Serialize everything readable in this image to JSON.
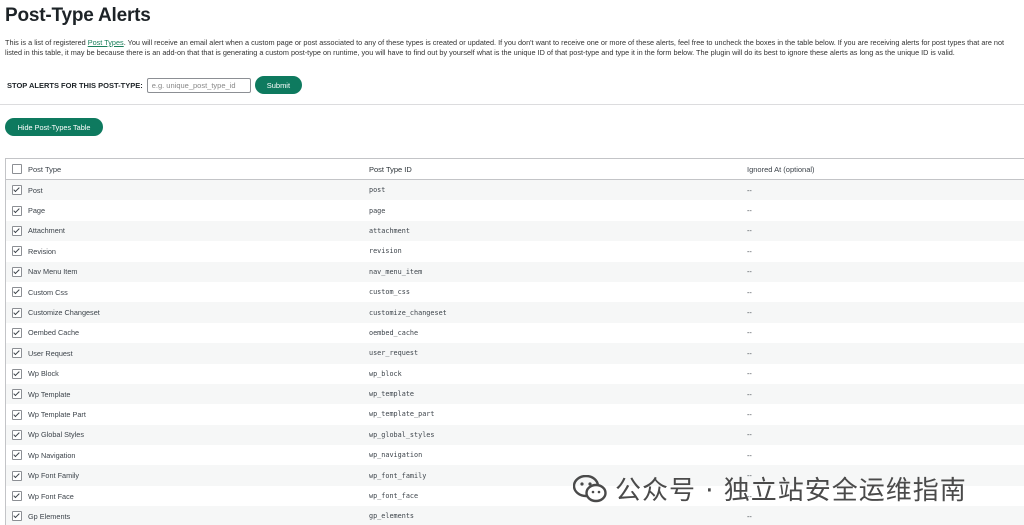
{
  "page": {
    "title": "Post-Type Alerts",
    "description_pre": "This is a list of registered ",
    "description_link": "Post Types",
    "description_post": ". You will receive an email alert when a custom page or post associated to any of these types is created or updated. If you don't want to receive one or more of these alerts, feel free to uncheck the boxes in the table below. If you are receiving alerts for post types that are not listed in this table, it may be because there is an add-on that that is generating a custom post-type on runtime, you will have to find out by yourself what is the unique ID of that post-type and type it in the form below. The plugin will do its best to ignore these alerts as long as the unique ID is valid."
  },
  "stop_form": {
    "label": "STOP ALERTS FOR THIS POST-TYPE:",
    "placeholder": "e.g. unique_post_type_id",
    "value": "",
    "submit_label": "Submit"
  },
  "toggle_button": {
    "label": "Hide Post-Types Table"
  },
  "table": {
    "headers": {
      "type": "Post Type",
      "id": "Post Type ID",
      "ignored": "Ignored At (optional)"
    },
    "rows": [
      {
        "type": "Post",
        "id": "post",
        "ignored": "--",
        "checked": true
      },
      {
        "type": "Page",
        "id": "page",
        "ignored": "--",
        "checked": true
      },
      {
        "type": "Attachment",
        "id": "attachment",
        "ignored": "--",
        "checked": true
      },
      {
        "type": "Revision",
        "id": "revision",
        "ignored": "--",
        "checked": true
      },
      {
        "type": "Nav Menu Item",
        "id": "nav_menu_item",
        "ignored": "--",
        "checked": true
      },
      {
        "type": "Custom Css",
        "id": "custom_css",
        "ignored": "--",
        "checked": true
      },
      {
        "type": "Customize Changeset",
        "id": "customize_changeset",
        "ignored": "--",
        "checked": true
      },
      {
        "type": "Oembed Cache",
        "id": "oembed_cache",
        "ignored": "--",
        "checked": true
      },
      {
        "type": "User Request",
        "id": "user_request",
        "ignored": "--",
        "checked": true
      },
      {
        "type": "Wp Block",
        "id": "wp_block",
        "ignored": "--",
        "checked": true
      },
      {
        "type": "Wp Template",
        "id": "wp_template",
        "ignored": "--",
        "checked": true
      },
      {
        "type": "Wp Template Part",
        "id": "wp_template_part",
        "ignored": "--",
        "checked": true
      },
      {
        "type": "Wp Global Styles",
        "id": "wp_global_styles",
        "ignored": "--",
        "checked": true
      },
      {
        "type": "Wp Navigation",
        "id": "wp_navigation",
        "ignored": "--",
        "checked": true
      },
      {
        "type": "Wp Font Family",
        "id": "wp_font_family",
        "ignored": "--",
        "checked": true
      },
      {
        "type": "Wp Font Face",
        "id": "wp_font_face",
        "ignored": "--",
        "checked": true
      },
      {
        "type": "Gp Elements",
        "id": "gp_elements",
        "ignored": "--",
        "checked": true
      }
    ]
  },
  "watermark": {
    "text": "公众号 · 独立站安全运维指南",
    "icon": "wechat-icon"
  },
  "colors": {
    "accent": "#0e7a5f",
    "link": "#1a7f5a",
    "row_alt": "#f6f7f7"
  }
}
